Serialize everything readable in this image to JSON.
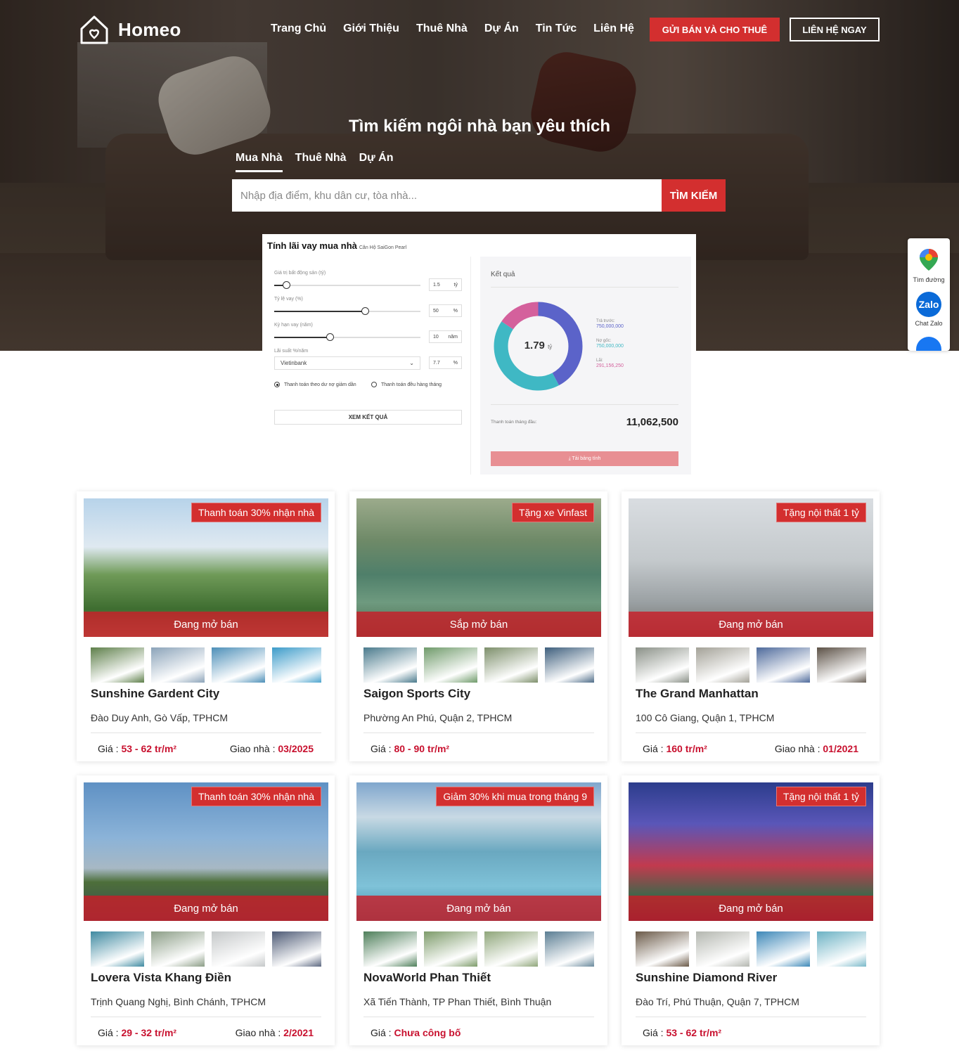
{
  "brand": {
    "name": "Homeo"
  },
  "nav": {
    "items": [
      "Trang Chủ",
      "Giới Thiệu",
      "Thuê Nhà",
      "Dự Án",
      "Tin Tức",
      "Liên Hệ"
    ],
    "cta_primary": "GỬI BÁN VÀ CHO THUÊ",
    "cta_secondary": "LIÊN HỆ NGAY"
  },
  "hero": {
    "title": "Tìm kiếm ngôi nhà bạn yêu thích",
    "tabs": [
      "Mua Nhà",
      "Thuê Nhà",
      "Dự Án"
    ],
    "active_tab": "Mua Nhà",
    "search_placeholder": "Nhập địa điểm, khu dân cư, tòa nhà...",
    "search_button": "TÌM KIẾM"
  },
  "calculator": {
    "title": "Tính lãi vay mua nhà",
    "subtitle": "Căn Hộ SaiGon Pearl",
    "fields": [
      {
        "label": "Giá trị bất động sản (tỷ)",
        "value": "1.5",
        "unit": "tỷ",
        "level": 0.08
      },
      {
        "label": "Tỷ lệ vay (%)",
        "value": "50",
        "unit": "%",
        "level": 0.62
      },
      {
        "label": "Kỳ hạn vay (năm)",
        "value": "10",
        "unit": "năm",
        "level": 0.38
      }
    ],
    "rate_label": "Lãi suất %/năm",
    "bank": "Vietinbank",
    "rate_value": "7.7",
    "rate_unit": "%",
    "radio_options": [
      "Thanh toán theo dư nợ giảm dần",
      "Thanh toán đều hàng tháng"
    ],
    "selected_radio": 0,
    "submit": "XEM KẾT QUẢ",
    "result_title": "Kết quả",
    "total": "1.79",
    "total_unit": "tỷ",
    "legend": [
      {
        "label": "Trả trước:",
        "value": "750,000,000",
        "color": "#5b63c9"
      },
      {
        "label": "Nợ gốc:",
        "value": "750,000,000",
        "color": "#3fb8c4"
      },
      {
        "label": "Lãi:",
        "value": "291,156,250",
        "color": "#d4609c"
      }
    ],
    "monthly_label": "Thanh toán tháng đầu:",
    "monthly_value": "11,062,500",
    "download": "⤓ Tải bảng tính"
  },
  "side_widget": {
    "items": [
      {
        "label": "Tìm đường",
        "icon": "map-pin-icon"
      },
      {
        "label": "Chat Zalo",
        "icon": "zalo-icon",
        "icon_text": "Zalo"
      },
      {
        "label": "",
        "icon": "messenger-icon"
      }
    ]
  },
  "projects": [
    {
      "name": "Sunshine Gardent City",
      "address": "Đào Duy Anh, Gò Vấp, TPHCM",
      "promo": "Thanh toán 30% nhận nhà",
      "status": "Đang mở bán",
      "price_label": "Giá :",
      "price": "53 - 62 tr/m²",
      "handover_label": "Giao nhà :",
      "handover": "03/2025"
    },
    {
      "name": "Saigon Sports City",
      "address": "Phường An Phú, Quận 2, TPHCM",
      "promo": "Tặng xe Vinfast",
      "status": "Sắp mở bán",
      "price_label": "Giá :",
      "price": "80 - 90 tr/m²",
      "handover_label": "",
      "handover": ""
    },
    {
      "name": "The Grand Manhattan",
      "address": "100 Cô Giang, Quận 1, TPHCM",
      "promo": "Tặng nội thất 1 tỷ",
      "status": "Đang mở bán",
      "price_label": "Giá :",
      "price": "160 tr/m²",
      "handover_label": "Giao nhà :",
      "handover": "01/2021"
    },
    {
      "name": "Lovera Vista Khang Điền",
      "address": "Trịnh Quang Nghị, Bình Chánh, TPHCM",
      "promo": "Thanh toán 30% nhận nhà",
      "status": "Đang mở bán",
      "price_label": "Giá :",
      "price": "29 - 32 tr/m²",
      "handover_label": "Giao nhà :",
      "handover": "2/2021"
    },
    {
      "name": "NovaWorld Phan Thiết",
      "address": "Xã Tiến Thành, TP Phan Thiết, Bình Thuận",
      "promo": "Giảm 30% khi mua trong tháng 9",
      "status": "Đang mở bán",
      "price_label": "Giá :",
      "price": "Chưa công bố",
      "handover_label": "",
      "handover": ""
    },
    {
      "name": "Sunshine Diamond River",
      "address": "Đào Trí, Phú Thuận, Quận 7, TPHCM",
      "promo": "Tặng nội thất 1 tỷ",
      "status": "Đang mở bán",
      "price_label": "Giá :",
      "price": "53 - 62 tr/m²",
      "handover_label": "",
      "handover": ""
    }
  ]
}
